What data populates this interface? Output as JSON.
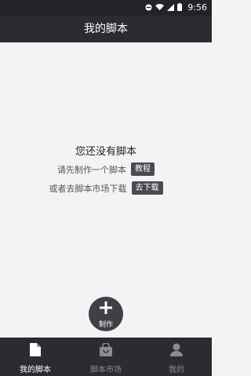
{
  "status_bar": {
    "time": "9:56",
    "icons": [
      "do-not-disturb-icon",
      "wifi-icon",
      "signal-icon",
      "battery-icon"
    ]
  },
  "header": {
    "title": "我的脚本"
  },
  "empty_state": {
    "title": "您还没有脚本",
    "row1_text": "请先制作一个脚本",
    "row1_button": "教程",
    "row2_text": "或者去脚本市场下载",
    "row2_button": "去下载"
  },
  "fab": {
    "label": "制作",
    "icon": "plus-icon"
  },
  "tabs": [
    {
      "label": "我的脚本",
      "icon": "document-icon",
      "active": true
    },
    {
      "label": "脚本市场",
      "icon": "shopping-bag-icon",
      "active": false
    },
    {
      "label": "我的",
      "icon": "person-icon",
      "active": false
    }
  ],
  "colors": {
    "bar_bg": "#2b2b30",
    "page_bg": "#f3f3f5",
    "tag_bg": "#4a4a4f",
    "active_tab": "#ffffff",
    "inactive_tab": "#8b8b90"
  }
}
